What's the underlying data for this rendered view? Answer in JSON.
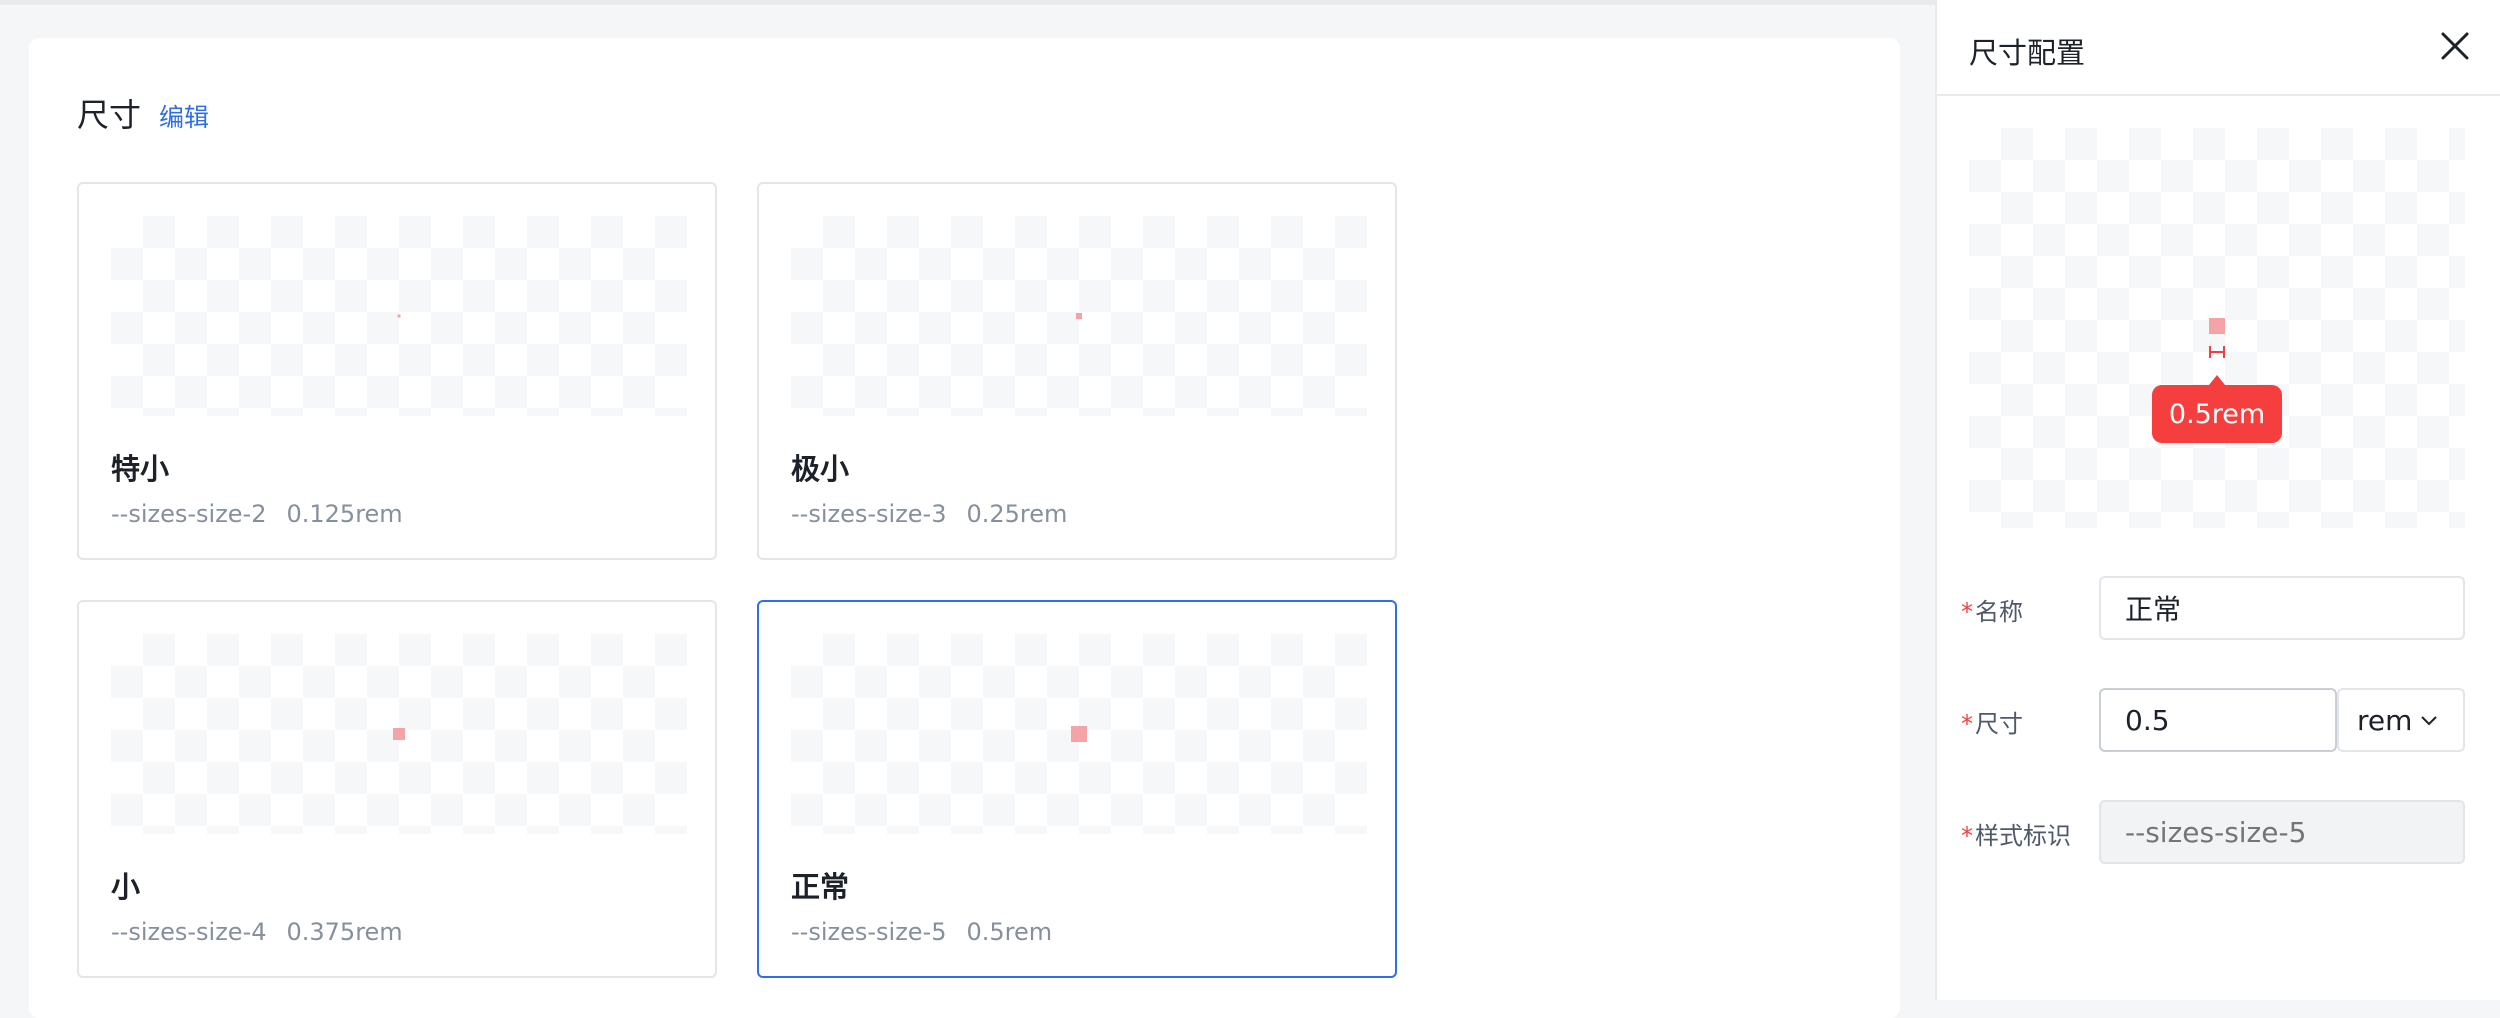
{
  "section": {
    "title": "尺寸",
    "edit_label": "编辑"
  },
  "cards": [
    {
      "name": "特小",
      "token": "--sizes-size-2",
      "value": "0.125rem"
    },
    {
      "name": "极小",
      "token": "--sizes-size-3",
      "value": "0.25rem"
    },
    {
      "name": "小",
      "token": "--sizes-size-4",
      "value": "0.375rem"
    },
    {
      "name": "正常",
      "token": "--sizes-size-5",
      "value": "0.5rem"
    }
  ],
  "selected_card_index": 3,
  "drawer": {
    "title": "尺寸配置",
    "close_icon": "close-icon",
    "preview_tooltip": "0.5rem",
    "form": {
      "required_mark": "*",
      "name_label": "名称",
      "name_value": "正常",
      "size_label": "尺寸",
      "size_value": "0.5",
      "unit_value": "rem",
      "style_id_label": "样式标识",
      "style_id_placeholder": "--sizes-size-5"
    }
  },
  "colors": {
    "accent": "#2f6fe6",
    "size_swatch": "#f4a3a6",
    "tooltip": "#f53f3f",
    "required": "#f53f3f"
  }
}
